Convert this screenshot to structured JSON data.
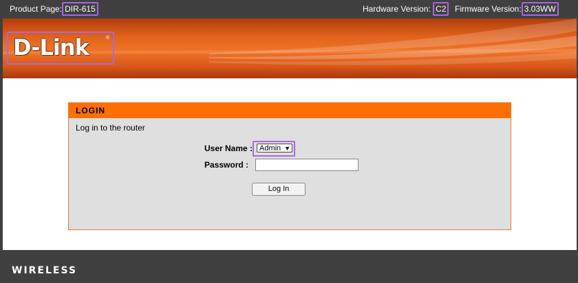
{
  "topbar": {
    "product_label": "Product Page:",
    "product_value": "DIR-615",
    "hardware_label": "Hardware Version:",
    "hardware_value": "C2",
    "firmware_label": "Firmware Version:",
    "firmware_value": "3.03WW"
  },
  "banner": {
    "logo_text": "D-Link",
    "logo_mark": "®"
  },
  "login": {
    "header": "LOGIN",
    "subtitle": "Log in to the router",
    "user_label": "User Name :",
    "user_selected": "Admin",
    "password_label": "Password :",
    "password_value": "",
    "button_label": "Log In"
  },
  "footer": {
    "text": "WIRELESS"
  },
  "colors": {
    "accent": "#ff6f00",
    "bar": "#404040",
    "panel": "#dfdfdf",
    "highlight": "#a569e0"
  }
}
